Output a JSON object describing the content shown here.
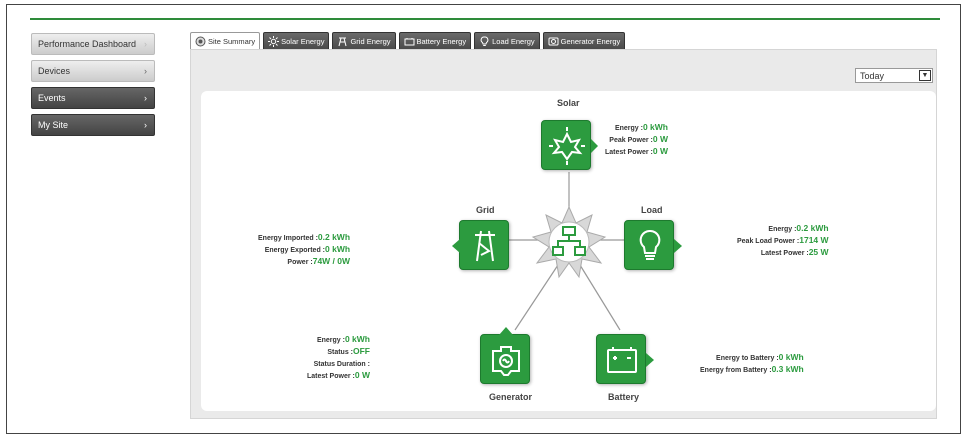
{
  "sidebar": {
    "items": [
      {
        "label": "Performance Dashboard",
        "chev": "›"
      },
      {
        "label": "Devices",
        "chev": "›"
      },
      {
        "label": "Events",
        "chev": "›"
      },
      {
        "label": "My Site",
        "chev": "›"
      }
    ]
  },
  "tabs": [
    {
      "label": "Site Summary",
      "icon": "site-summary-icon"
    },
    {
      "label": "Solar Energy",
      "icon": "solar-icon"
    },
    {
      "label": "Grid Energy",
      "icon": "grid-icon"
    },
    {
      "label": "Battery Energy",
      "icon": "battery-icon"
    },
    {
      "label": "Load Energy",
      "icon": "load-icon"
    },
    {
      "label": "Generator Energy",
      "icon": "generator-icon"
    }
  ],
  "period_select": {
    "value": "Today",
    "arrow": "▼"
  },
  "diagram": {
    "colors": {
      "node": "#2c9b3f",
      "value": "#2c9b3f",
      "lines": "#999999"
    },
    "solar": {
      "title": "Solar",
      "stats": [
        {
          "label": "Energy :",
          "value": "0 kWh"
        },
        {
          "label": "Peak Power :",
          "value": "0 W"
        },
        {
          "label": "Latest Power :",
          "value": "0 W"
        }
      ]
    },
    "grid": {
      "title": "Grid",
      "stats": [
        {
          "label": "Energy Imported :",
          "value": "0.2 kWh"
        },
        {
          "label": "Energy Exported :",
          "value": "0 kWh"
        },
        {
          "label": "Power :",
          "value": "74W / 0W"
        }
      ]
    },
    "load": {
      "title": "Load",
      "stats": [
        {
          "label": "Energy :",
          "value": "0.2 kWh"
        },
        {
          "label": "Peak Load Power :",
          "value": "1714 W"
        },
        {
          "label": "Latest Power :",
          "value": "25 W"
        }
      ]
    },
    "generator": {
      "title": "Generator",
      "stats": [
        {
          "label": "Energy :",
          "value": "0 kWh"
        },
        {
          "label": "Status :",
          "value": "OFF"
        },
        {
          "label": "Status Duration :",
          "value": ""
        },
        {
          "label": "Latest Power :",
          "value": "0 W"
        }
      ]
    },
    "battery": {
      "title": "Battery",
      "stats": [
        {
          "label": "Energy to Battery :",
          "value": "0 kWh"
        },
        {
          "label": "Energy from Battery :",
          "value": "0.3 kWh"
        }
      ]
    }
  }
}
